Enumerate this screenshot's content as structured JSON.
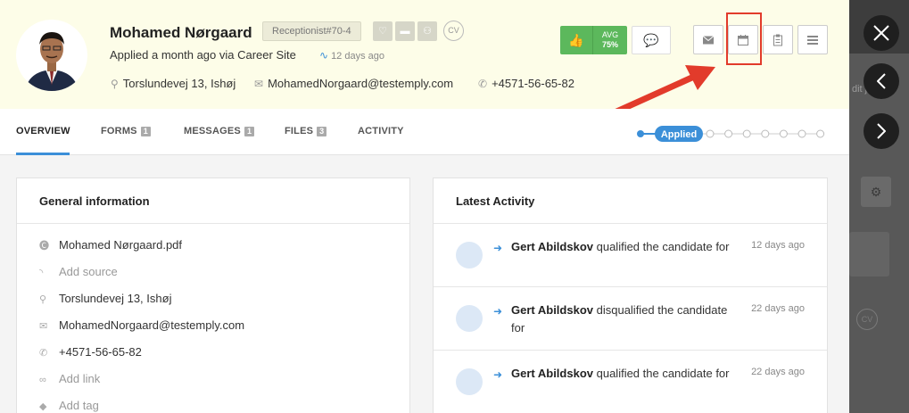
{
  "candidate": {
    "name": "Mohamed Nørgaard",
    "job_badge": "Receptionist#70-4",
    "cv_label": "CV",
    "applied_text": "Applied a month ago via Career Site",
    "days_ago": "12 days ago",
    "address": "Torslundevej 13, Ishøj",
    "email": "MohamedNorgaard@testemply.com",
    "phone": "+4571-56-65-82"
  },
  "rating": {
    "avg_label": "AVG",
    "avg_value": "75%"
  },
  "tabs": [
    {
      "label": "OVERVIEW",
      "count": ""
    },
    {
      "label": "FORMS",
      "count": "1"
    },
    {
      "label": "MESSAGES",
      "count": "1"
    },
    {
      "label": "FILES",
      "count": "3"
    },
    {
      "label": "ACTIVITY",
      "count": ""
    }
  ],
  "pipeline": {
    "current_stage": "Applied",
    "remaining_steps": 7
  },
  "general_info": {
    "title": "General information",
    "rows": [
      {
        "icon": "cv-icon",
        "text": "Mohamed Nørgaard.pdf",
        "muted": false
      },
      {
        "icon": "rss-icon",
        "text": "Add source",
        "muted": true
      },
      {
        "icon": "map-pin-icon",
        "text": "Torslundevej 13, Ishøj",
        "muted": false
      },
      {
        "icon": "envelope-icon",
        "text": "MohamedNorgaard@testemply.com",
        "muted": false
      },
      {
        "icon": "phone-icon",
        "text": "+4571-56-65-82",
        "muted": false
      },
      {
        "icon": "link-icon",
        "text": "Add link",
        "muted": true
      },
      {
        "icon": "tag-icon",
        "text": "Add tag",
        "muted": true
      }
    ]
  },
  "latest_activity": {
    "title": "Latest Activity",
    "items": [
      {
        "actor": "Gert Abildskov",
        "action": "qualified the candidate for",
        "when": "12 days ago"
      },
      {
        "actor": "Gert Abildskov",
        "action": "disqualified the candidate for",
        "when": "22 days ago"
      },
      {
        "actor": "Gert Abildskov",
        "action": "qualified the candidate for",
        "when": "22 days ago"
      }
    ]
  },
  "background": {
    "edit_label": "dit job",
    "cv_label": "CV"
  },
  "colors": {
    "accent": "#3b8fd8",
    "green": "#5cb85c",
    "highlight": "#e23b2b",
    "header_bg": "#fdfde8"
  }
}
